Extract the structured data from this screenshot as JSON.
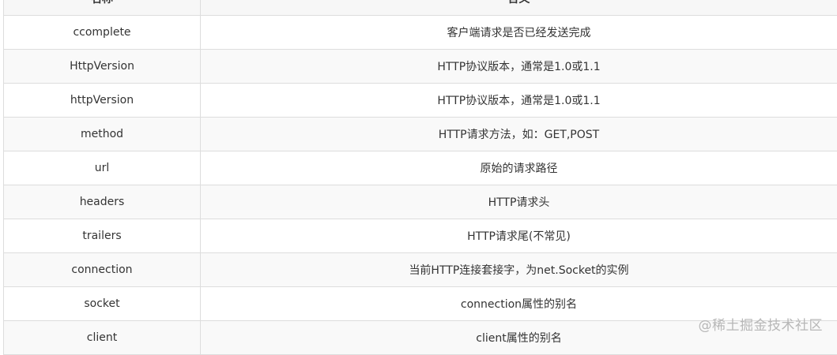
{
  "table": {
    "headers": [
      "名称",
      "含义"
    ],
    "rows": [
      {
        "name": "ccomplete",
        "meaning": "客户端请求是否已经发送完成"
      },
      {
        "name": "HttpVersion",
        "meaning": "HTTP协议版本，通常是1.0或1.1"
      },
      {
        "name": "httpVersion",
        "meaning": "HTTP协议版本，通常是1.0或1.1"
      },
      {
        "name": "method",
        "meaning": "HTTP请求方法，如：GET,POST"
      },
      {
        "name": "url",
        "meaning": "原始的请求路径"
      },
      {
        "name": "headers",
        "meaning": "HTTP请求头"
      },
      {
        "name": "trailers",
        "meaning": "HTTP请求尾(不常见)"
      },
      {
        "name": "connection",
        "meaning": "当前HTTP连接套接字，为net.Socket的实例"
      },
      {
        "name": "socket",
        "meaning": "connection属性的别名"
      },
      {
        "name": "client",
        "meaning": "client属性的别名"
      }
    ]
  },
  "watermark": "@稀土掘金技术社区"
}
